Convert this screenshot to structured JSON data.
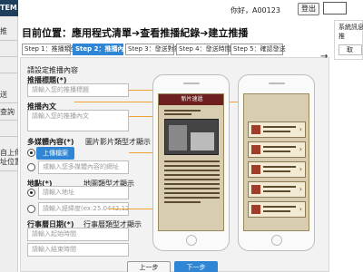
{
  "sidebar": {
    "header": "TEM",
    "items": [
      "推",
      "",
      "",
      "送",
      "查詢",
      "",
      "自上傳",
      "址位置"
    ]
  },
  "header": {
    "greeting": "你好，A00123",
    "logout": "登出"
  },
  "breadcrumb": "目前位置：應用程式清單➔查看推播紀錄➔建立推播",
  "steps": [
    {
      "label": "Step 1：推播類型",
      "active": false
    },
    {
      "label": "Step 2：推播內容",
      "active": true
    },
    {
      "label": "Step 3：發送對象",
      "active": false
    },
    {
      "label": "Step 4：發送時間",
      "active": false
    },
    {
      "label": "Step 5：確認發送",
      "active": false
    }
  ],
  "form": {
    "section_title": "請設定推播內容",
    "title_label": "推播標題(*)",
    "title_placeholder": "請輸入您的推播標題",
    "content_label": "推播內文",
    "content_placeholder": "請輸入您的推播內文",
    "media_label": "多媒體內容(*)",
    "media_hint": "圖片影片類型才顯示",
    "upload_button": "上傳檔案",
    "media_url_placeholder": "或輸入您多媒體內容的網址",
    "location_label": "地點(*)",
    "location_hint": "地圖類型才顯示",
    "address_placeholder": "請輸入地址",
    "coords_placeholder": "請輸入經緯度(ex:25.0442,121.5586)",
    "date_label": "行事曆日期(*)",
    "date_hint": "行事曆類型才顯示",
    "start_placeholder": "請輸入起始時間",
    "end_placeholder": "請輸入結束時間"
  },
  "phone_left": {
    "bar_title": "新片速遞"
  },
  "buttons": {
    "prev": "上一步",
    "next": "下一步"
  },
  "right_panel": {
    "line1": "系統訊息",
    "line2": "推",
    "button": "取"
  },
  "colors": {
    "accent": "#2f86d4",
    "annotation": "#f2a230",
    "header_bar": "#6e1e1e"
  }
}
